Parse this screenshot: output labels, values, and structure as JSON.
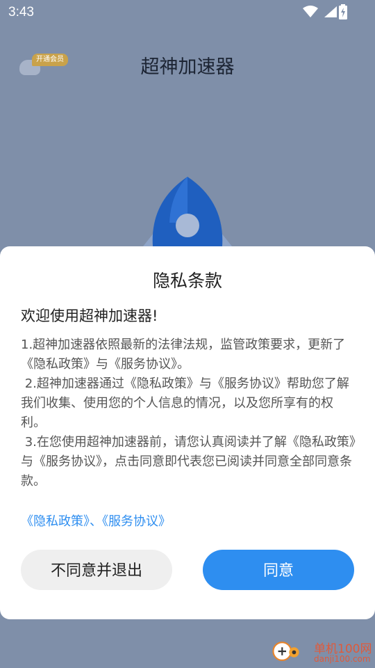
{
  "status_bar": {
    "time": "3:43"
  },
  "app_bar": {
    "title": "超神加速器",
    "vip_badge": "开通会员"
  },
  "dialog": {
    "title": "隐私条款",
    "welcome": "欢迎使用超神加速器!",
    "paragraphs": [
      "1.超神加速器依照最新的法律法规，监管政策要求，更新了《隐私政策》与《服务协议》。",
      " 2.超神加速器通过《隐私政策》与《服务协议》帮助您了解我们收集、使用您的个人信息的情况，以及您所享有的权利。",
      " 3.在您使用超神加速器前，请您认真阅读并了解《隐私政策》与《服务协议》，点击同意即代表您已阅读并同意全部同意条款。"
    ],
    "links": {
      "privacy": "《隐私政策》",
      "separator": "、",
      "service": "《服务协议》"
    },
    "buttons": {
      "decline": "不同意并退出",
      "agree": "同意"
    }
  },
  "watermark": {
    "name": "单机100网",
    "url": "danji100.com"
  },
  "colors": {
    "accent": "#2e8ef0",
    "overlay": "#7f8fa9",
    "rocket": "#1f5fbf"
  }
}
